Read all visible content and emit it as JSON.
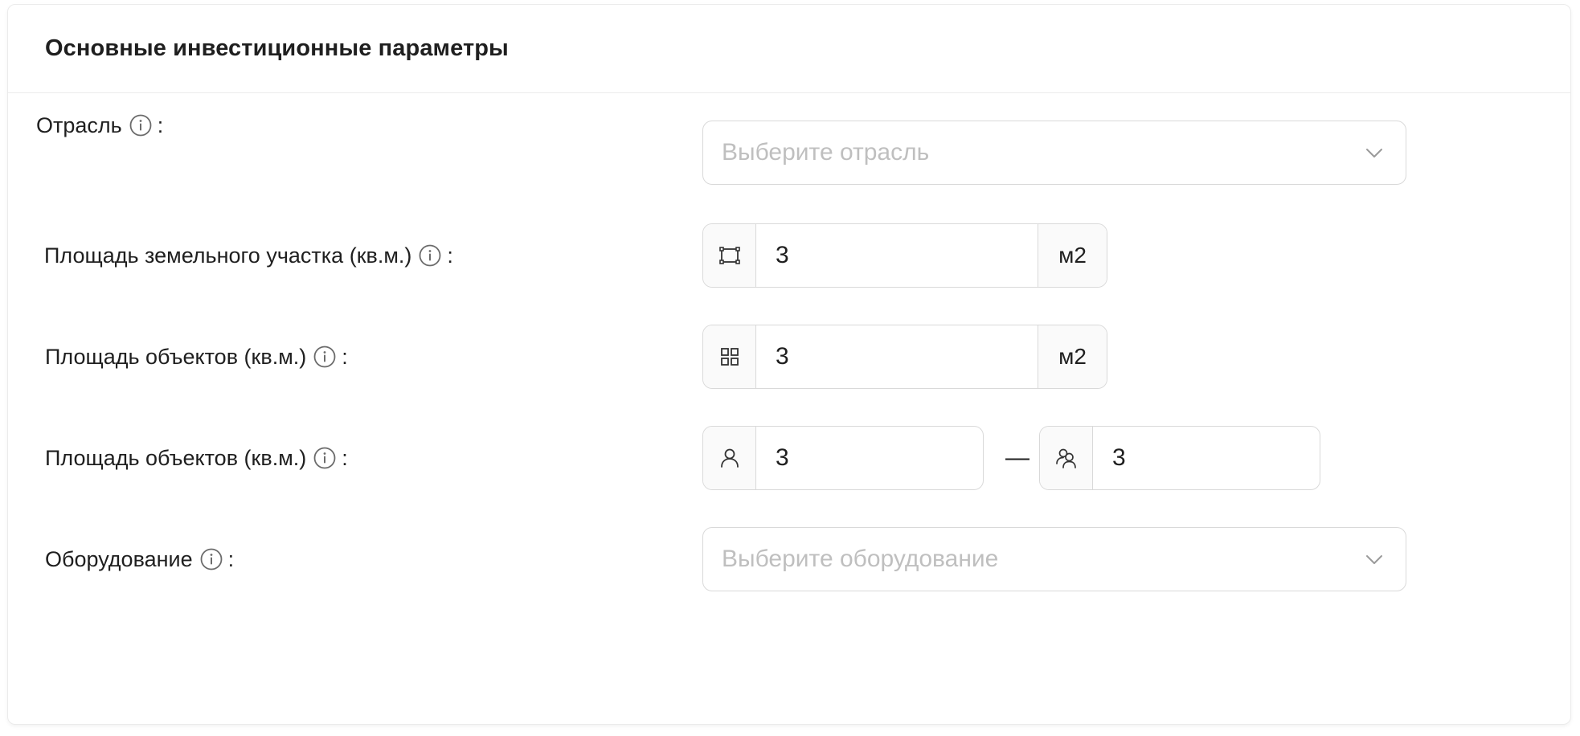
{
  "card": {
    "title": "Основные инвестиционные параметры"
  },
  "rows": {
    "industry": {
      "label": "Отрасль",
      "placeholder": "Выберите отрасль"
    },
    "land_area": {
      "label": "Площадь земельного участка (кв.м.)",
      "value": "3",
      "unit": "м2"
    },
    "objects_area": {
      "label": "Площадь объектов (кв.м.)",
      "value": "3",
      "unit": "м2"
    },
    "objects_area_range": {
      "label": "Площадь объектов (кв.м.)",
      "value_from": "3",
      "separator": "—",
      "value_to": "3"
    },
    "equipment": {
      "label": "Оборудование",
      "placeholder": "Выберите оборудование"
    }
  },
  "colon": ":",
  "icons": {
    "info": "info-circle-icon",
    "dropdown": "chevron-down-icon",
    "land": "area-frame-icon",
    "objects": "grid-icon",
    "user": "user-icon",
    "users": "users-icon"
  },
  "colors": {
    "border": "#d9d9d9",
    "placeholder": "#bfbfbf",
    "addon_bg": "#fafafa",
    "text": "#1f1f1f"
  }
}
